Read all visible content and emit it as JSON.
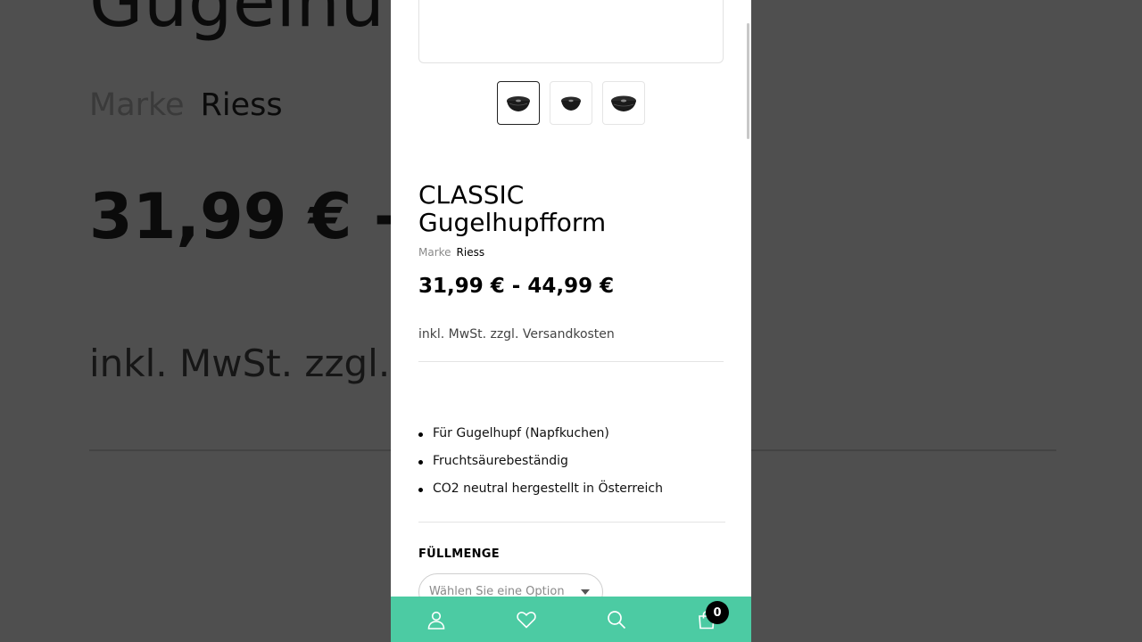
{
  "product": {
    "title_line1": "CLASSIC",
    "title_line2": "Gugelhupfform",
    "brand_label": "Marke",
    "brand_value": "Riess",
    "price": "31,99 € - 44,99 €",
    "tax_note": "inkl. MwSt. zzgl. Versandkosten",
    "features": [
      "Für Gugelhupf (Napfkuchen)",
      "Fruchtsäurebeständig",
      "CO2 neutral hergestellt in Österreich"
    ],
    "thumbnails": [
      "bundt-pan-image-1",
      "bundt-pan-image-2",
      "bundt-pan-image-3"
    ],
    "selected_thumbnail": 1
  },
  "variant": {
    "label": "FÜLLMENGE",
    "placeholder": "Wählen Sie eine Option"
  },
  "background": {
    "title": "Gugelhu",
    "brand_label": "Marke",
    "brand_value": "Riess",
    "price": "31,99 € -",
    "tax_note": "inkl. MwSt. zzgl."
  },
  "bottom_nav": {
    "items": [
      "user-icon",
      "heart-icon",
      "search-icon",
      "shopping-bag-icon"
    ],
    "cart_count": "0"
  },
  "colors": {
    "accent": "#4ccba3",
    "backdrop": "#4f4f4f",
    "badge": "#000000"
  }
}
